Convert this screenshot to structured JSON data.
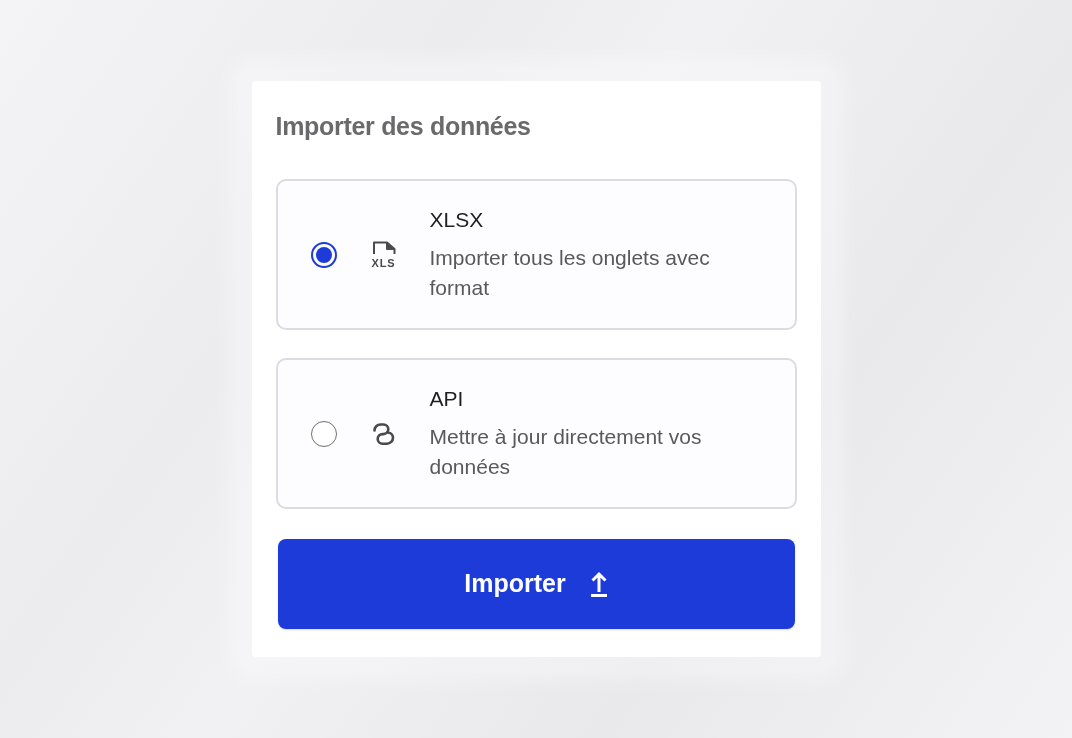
{
  "title": "Importer des données",
  "options": [
    {
      "kind": "file",
      "icon_label": "XLS",
      "title": "XLSX",
      "description": "Importer tous les onglets avec format",
      "selected": true
    },
    {
      "kind": "api",
      "title": "API",
      "description": "Mettre à jour directement vos données",
      "selected": false
    }
  ],
  "button": {
    "label": "Importer"
  }
}
